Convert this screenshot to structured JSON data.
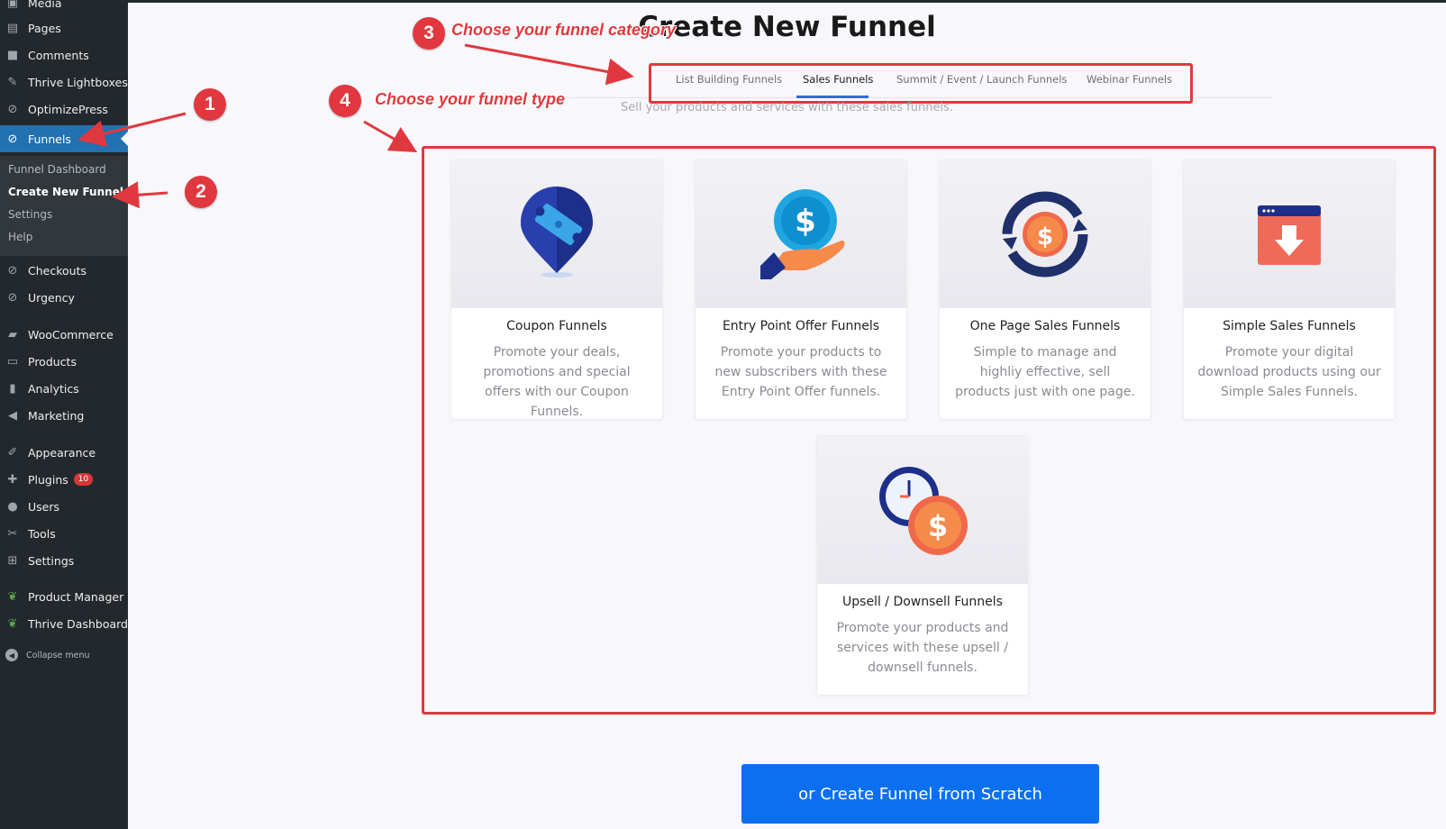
{
  "sidebar": {
    "top_item": {
      "label": "Media",
      "icon": "media-icon"
    },
    "items": [
      {
        "label": "Pages",
        "icon": "pages-icon"
      },
      {
        "label": "Comments",
        "icon": "comments-icon"
      },
      {
        "label": "Thrive Lightboxes",
        "icon": "pin-icon"
      },
      {
        "label": "OptimizePress",
        "icon": "optimizepress-icon"
      },
      {
        "label": "Funnels",
        "icon": "funnels-icon",
        "active": true
      },
      {
        "label": "Checkouts",
        "icon": "checkouts-icon"
      },
      {
        "label": "Urgency",
        "icon": "urgency-icon"
      },
      {
        "label": "WooCommerce",
        "icon": "woocommerce-icon"
      },
      {
        "label": "Products",
        "icon": "products-icon"
      },
      {
        "label": "Analytics",
        "icon": "analytics-icon"
      },
      {
        "label": "Marketing",
        "icon": "marketing-icon"
      },
      {
        "label": "Appearance",
        "icon": "appearance-icon"
      },
      {
        "label": "Plugins",
        "icon": "plugins-icon",
        "badge": "10"
      },
      {
        "label": "Users",
        "icon": "users-icon"
      },
      {
        "label": "Tools",
        "icon": "tools-icon"
      },
      {
        "label": "Settings",
        "icon": "settings-icon"
      },
      {
        "label": "Product Manager",
        "icon": "leaf-icon"
      },
      {
        "label": "Thrive Dashboard",
        "icon": "leaf-icon"
      }
    ],
    "submenu": [
      "Funnel Dashboard",
      "Create New Funnel",
      "Settings",
      "Help"
    ],
    "current_submenu": "Create New Funnel",
    "collapse_label": "Collapse menu"
  },
  "page": {
    "title": "Create New Funnel",
    "tabs": [
      "List Building Funnels",
      "Sales Funnels",
      "Summit / Event / Launch Funnels",
      "Webinar Funnels"
    ],
    "active_tab": "Sales Funnels",
    "category_description": "Sell your products and services with these sales funnels.",
    "cards": [
      {
        "title": "Coupon Funnels",
        "description": "Promote your deals, promotions and special offers with our Coupon Funnels.",
        "icon": "coupon-pin-icon"
      },
      {
        "title": "Entry Point Offer Funnels",
        "description": "Promote your products to new subscribers with these Entry Point Offer funnels.",
        "icon": "hand-dollar-icon"
      },
      {
        "title": "One Page Sales Funnels",
        "description": "Simple to manage and highliy effective, sell products just with one page.",
        "icon": "cycle-dollar-icon"
      },
      {
        "title": "Simple Sales Funnels",
        "description": "Promote your digital download products using our Simple Sales Funnels.",
        "icon": "download-window-icon"
      },
      {
        "title": "Upsell / Downsell Funnels",
        "description": "Promote your products and services with these upsell / downsell funnels.",
        "icon": "clock-dollar-icon"
      }
    ],
    "scratch_button": "or Create Funnel from Scratch"
  },
  "annotations": {
    "steps": [
      "1",
      "2",
      "3",
      "4"
    ],
    "step3_text": "Choose your funnel category",
    "step4_text": "Choose your funnel type",
    "color": "#e0383e"
  },
  "colors": {
    "sidebar_bg": "#23282d",
    "active_menu": "#2271b1",
    "primary_button": "#0b6ff0"
  }
}
